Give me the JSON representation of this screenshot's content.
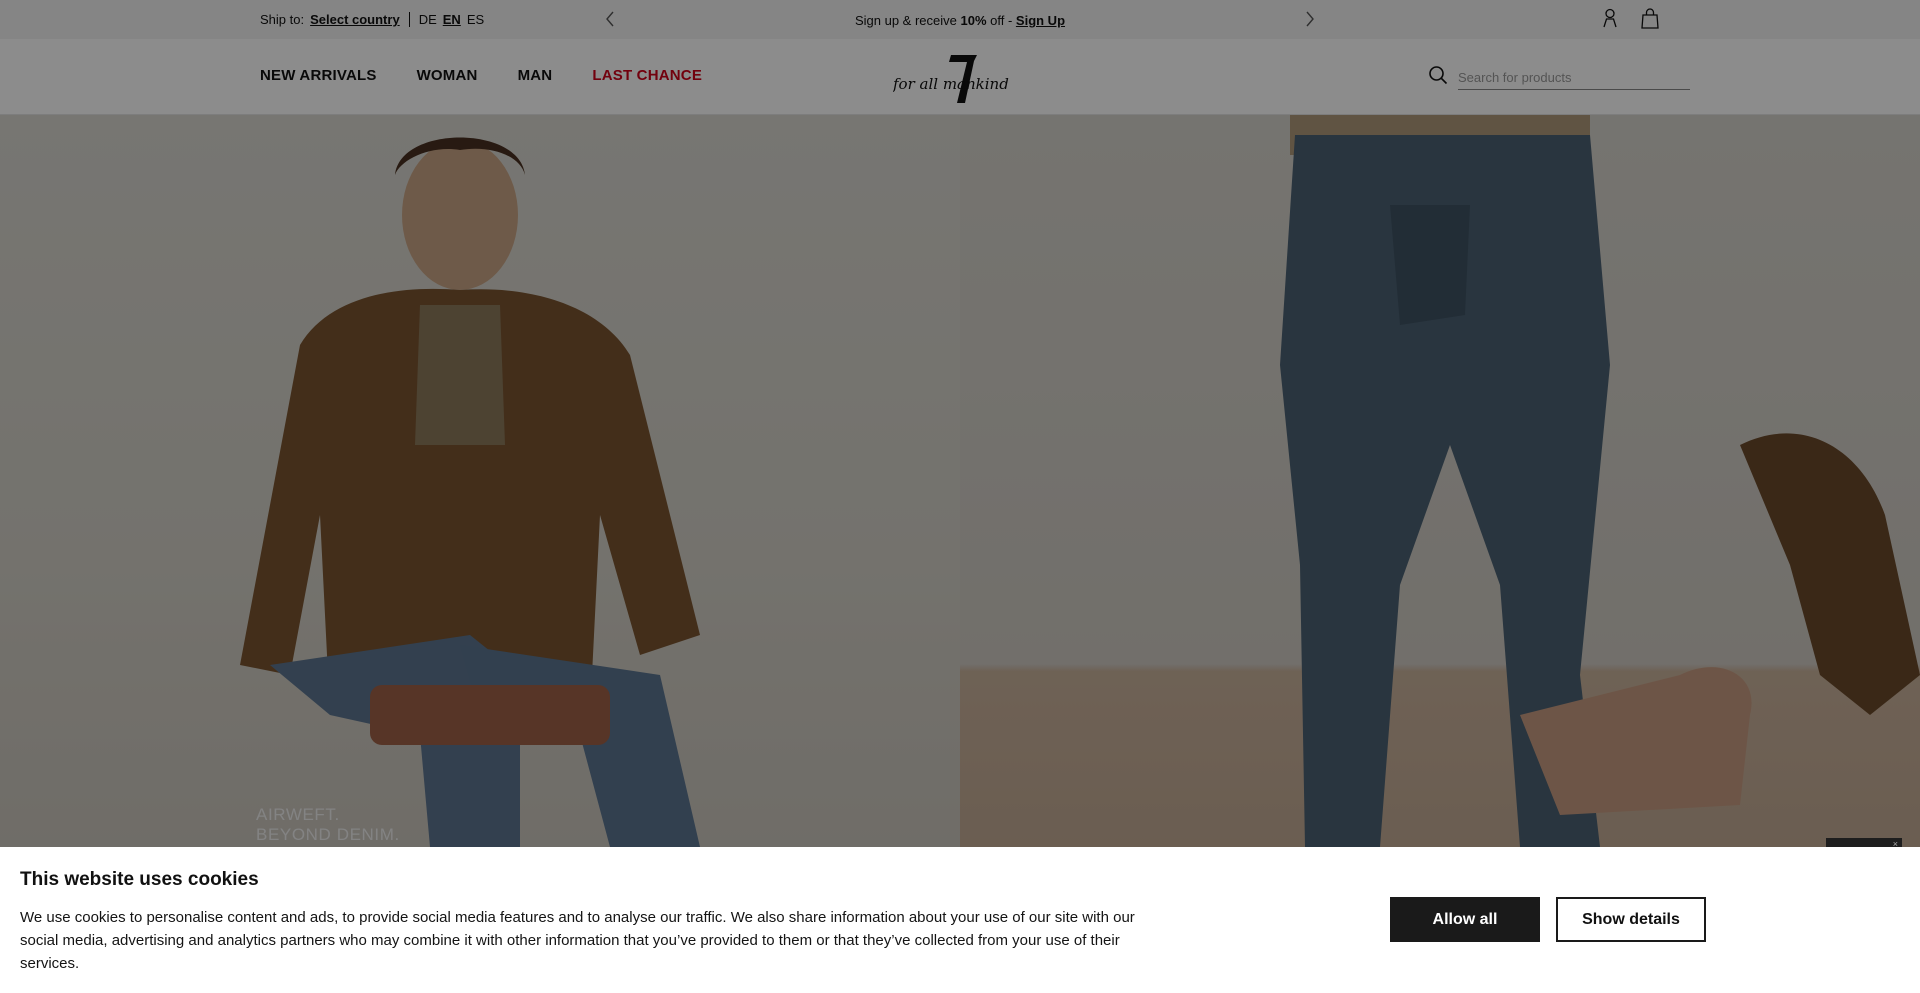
{
  "topbar": {
    "ship_to_label": "Ship to:",
    "ship_to_link": "Select country",
    "languages": [
      "DE",
      "EN",
      "ES"
    ],
    "active_language": "EN",
    "promo_prefix": "Sign up & receive ",
    "promo_bold": "10%",
    "promo_middle": " off - ",
    "promo_link": "Sign Up"
  },
  "nav": {
    "items": [
      "NEW ARRIVALS",
      "WOMAN",
      "MAN",
      "LAST CHANCE"
    ],
    "sale_color": "#d0021b"
  },
  "logo": {
    "text": "for all mankind",
    "number": "7"
  },
  "search": {
    "placeholder": "Search for products"
  },
  "hero": {
    "headline_line1": "AIRWEFT.",
    "headline_line2": "BEYOND DENIM."
  },
  "cookie": {
    "title": "This website uses cookies",
    "body": "We use cookies to personalise content and ads, to provide social media features and to analyse our traffic. We also share information about your use of our site with our social media, advertising and analytics partners who may combine it with other information that you’ve provided to them or that they’ve collected from your use of their services.",
    "allow_label": "Allow all",
    "details_label": "Show details"
  },
  "icons": {
    "prev": "chevron-left-icon",
    "next": "chevron-right-icon",
    "account": "user-icon",
    "cart": "shopping-bag-icon",
    "search": "search-icon"
  }
}
